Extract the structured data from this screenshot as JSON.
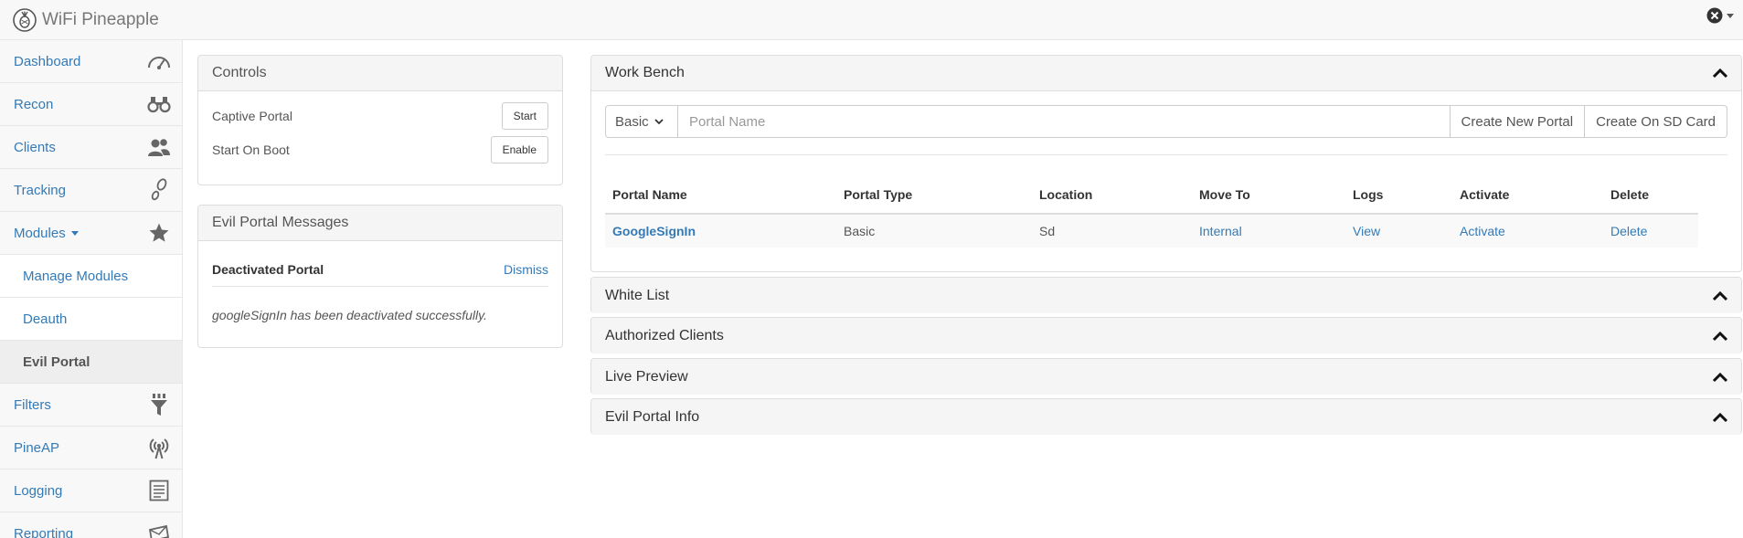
{
  "app": {
    "title": "WiFi Pineapple"
  },
  "sidebar": {
    "items": [
      {
        "label": "Dashboard",
        "icon": "gauge-icon"
      },
      {
        "label": "Recon",
        "icon": "binoculars-icon"
      },
      {
        "label": "Clients",
        "icon": "users-icon"
      },
      {
        "label": "Tracking",
        "icon": "footprints-icon"
      },
      {
        "label": "Modules",
        "icon": "star-icon"
      },
      {
        "label": "Manage Modules"
      },
      {
        "label": "Deauth"
      },
      {
        "label": "Evil Portal"
      },
      {
        "label": "Filters",
        "icon": "filter-icon"
      },
      {
        "label": "PineAP",
        "icon": "antenna-icon"
      },
      {
        "label": "Logging",
        "icon": "log-icon"
      },
      {
        "label": "Reporting",
        "icon": "envelope-icon"
      }
    ]
  },
  "controls": {
    "title": "Controls",
    "rows": [
      {
        "label": "Captive Portal",
        "button": "Start"
      },
      {
        "label": "Start On Boot",
        "button": "Enable"
      }
    ]
  },
  "messages": {
    "title": "Evil Portal Messages",
    "message_title": "Deactivated Portal",
    "dismiss": "Dismiss",
    "body": "googleSignIn has been deactivated successfully."
  },
  "workbench": {
    "title": "Work Bench",
    "type_selected": "Basic",
    "name_placeholder": "Portal Name",
    "create_button": "Create New Portal",
    "create_sd_button": "Create On SD Card",
    "columns": [
      "Portal Name",
      "Portal Type",
      "Location",
      "Move To",
      "Logs",
      "Activate",
      "Delete"
    ],
    "rows": [
      {
        "name": "GoogleSignIn",
        "type": "Basic",
        "location": "Sd",
        "move_to": "Internal",
        "logs": "View",
        "activate": "Activate",
        "delete": "Delete"
      }
    ]
  },
  "collapsed_panels": [
    {
      "title": "White List"
    },
    {
      "title": "Authorized Clients"
    },
    {
      "title": "Live Preview"
    },
    {
      "title": "Evil Portal Info"
    }
  ],
  "colors": {
    "link": "#337ab7",
    "navbar_bg": "#f8f8f8",
    "border": "#dddddd"
  }
}
